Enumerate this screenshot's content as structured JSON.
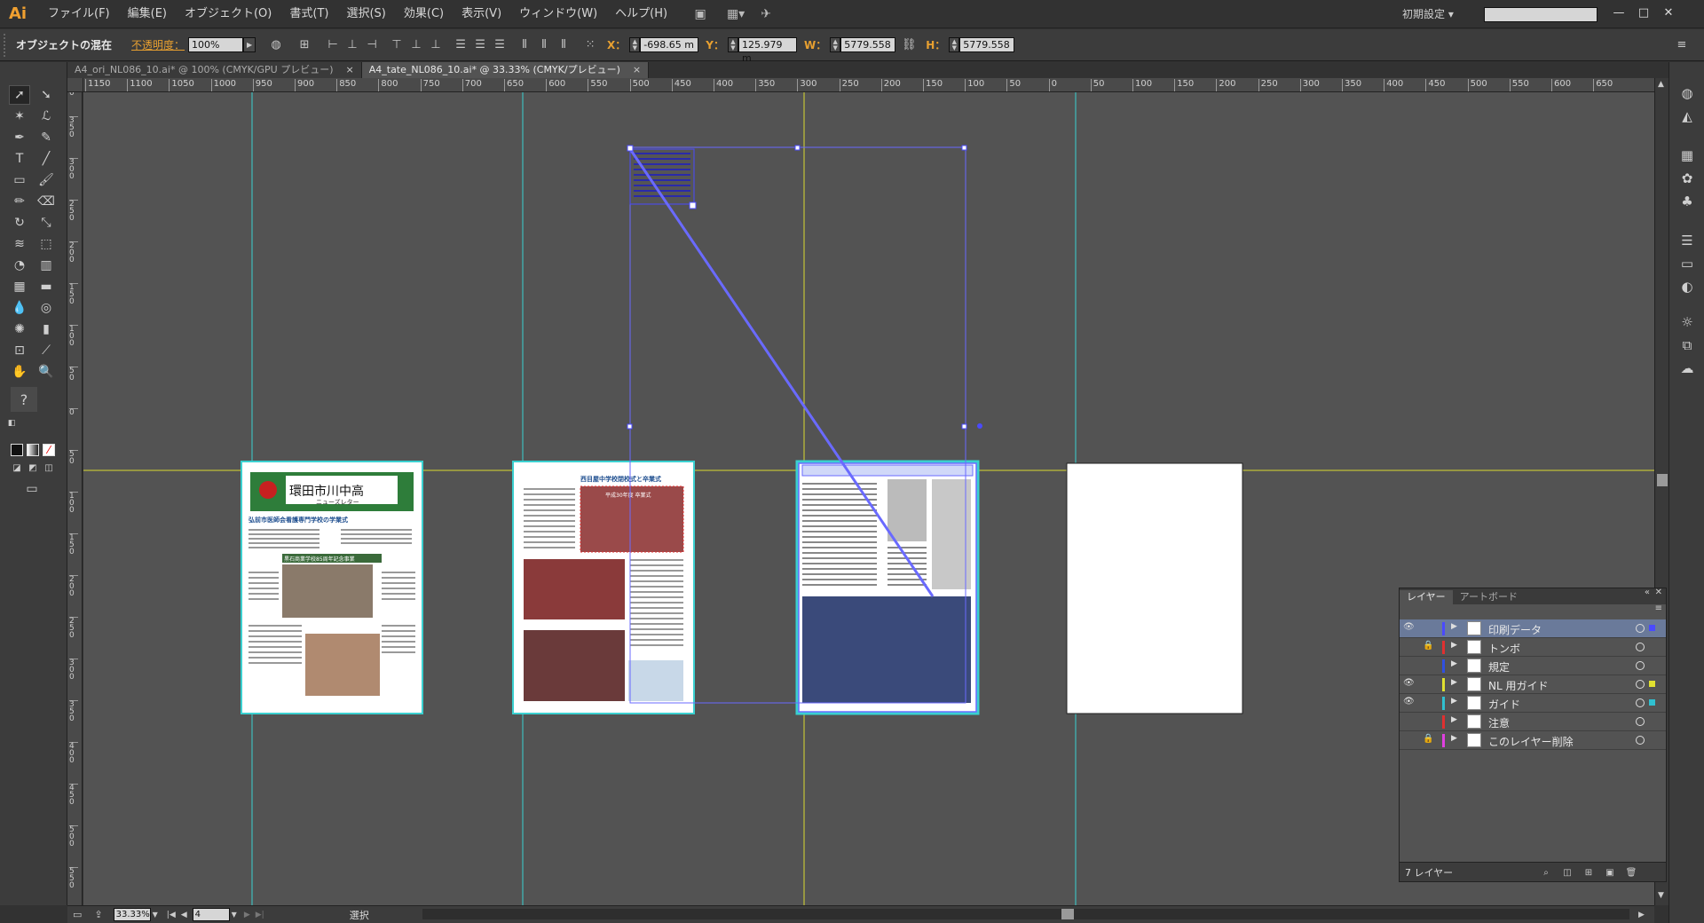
{
  "app": {
    "logo": "Ai",
    "workspace": "初期設定",
    "workspace_caret": "▾",
    "search_placeholder": ""
  },
  "menu": [
    "ファイル(F)",
    "編集(E)",
    "オブジェクト(O)",
    "書式(T)",
    "選択(S)",
    "効果(C)",
    "表示(V)",
    "ウィンドウ(W)",
    "ヘルプ(H)"
  ],
  "control": {
    "selection_label": "オブジェクトの混在",
    "opacity_label": "不透明度：",
    "opacity_value": "100%",
    "x_label": "X：",
    "x_value": "-698.65 m",
    "y_label": "Y：",
    "y_value": "125.979 m",
    "w_label": "W：",
    "w_value": "5779.558",
    "h_label": "H：",
    "h_value": "5779.558"
  },
  "tabs": [
    {
      "label": "A4_ori_NL086_10.ai* @ 100% (CMYK/GPU プレビュー)",
      "close": "×"
    },
    {
      "label": "A4_tate_NL086_10.ai* @ 33.33% (CMYK/プレビュー)",
      "close": "×"
    }
  ],
  "ruler_h": [
    "1150",
    "1100",
    "1050",
    "1000",
    "950",
    "900",
    "850",
    "800",
    "750",
    "700",
    "650",
    "600",
    "550",
    "500",
    "450",
    "400",
    "350",
    "300",
    "250",
    "200",
    "150",
    "100",
    "50",
    "0",
    "50",
    "100",
    "150",
    "200",
    "250",
    "300",
    "350",
    "400",
    "450",
    "500",
    "550",
    "600",
    "650"
  ],
  "ruler_v": [
    "4 0 0",
    "3 5 0",
    "3 0 0",
    "2 5 0",
    "2 0 0",
    "1 5 0",
    "1 0 0",
    "5 0",
    "0",
    "5 0",
    "1 0 0",
    "1 5 0",
    "2 0 0",
    "2 5 0",
    "3 0 0",
    "3 5 0",
    "4 0 0",
    "4 5 0",
    "5 0 0",
    "5 5 0"
  ],
  "status": {
    "zoom": "33.33%",
    "artboard_number": "4",
    "tool_label": "選択"
  },
  "artboards": {
    "p1_title_jp": "環田市川中高",
    "p1_title_sub": "ニューズレター",
    "p1_headline": "弘前市医師会看護専門学校の学業式",
    "p1_caption": "黒石商業学校85周年記念事業",
    "p2_headline": "西目屋中学校閉校式と卒業式",
    "p2_top_caption": "平成30年度 卒業式"
  },
  "layers_panel": {
    "tab_layers": "レイヤー",
    "tab_artboards": "アートボード",
    "footer_count": "7 レイヤー",
    "layers": [
      {
        "name": "印刷データ",
        "color": "#4a4aff",
        "visible": true,
        "locked": false,
        "selected": true,
        "sel_color": "#4a4aff"
      },
      {
        "name": "トンボ",
        "color": "#e03030",
        "visible": false,
        "locked": true,
        "selected": false,
        "sel_color": ""
      },
      {
        "name": "規定",
        "color": "#3050e0",
        "visible": false,
        "locked": false,
        "selected": false,
        "sel_color": ""
      },
      {
        "name": "NL 用ガイド",
        "color": "#e0e030",
        "visible": true,
        "locked": false,
        "selected": false,
        "sel_color": "#e0e030"
      },
      {
        "name": "ガイド",
        "color": "#30c0d0",
        "visible": true,
        "locked": false,
        "selected": false,
        "sel_color": "#30c0d0"
      },
      {
        "name": "注意",
        "color": "#e03030",
        "visible": false,
        "locked": false,
        "selected": false,
        "sel_color": ""
      },
      {
        "name": "このレイヤー削除",
        "color": "#e040e0",
        "visible": false,
        "locked": true,
        "selected": false,
        "sel_color": ""
      }
    ]
  },
  "colors": {
    "accent": "#e8a030",
    "selection": "#6a6aff",
    "guide_cyan": "#3ad0d0",
    "guide_yellow": "#e0e030"
  }
}
